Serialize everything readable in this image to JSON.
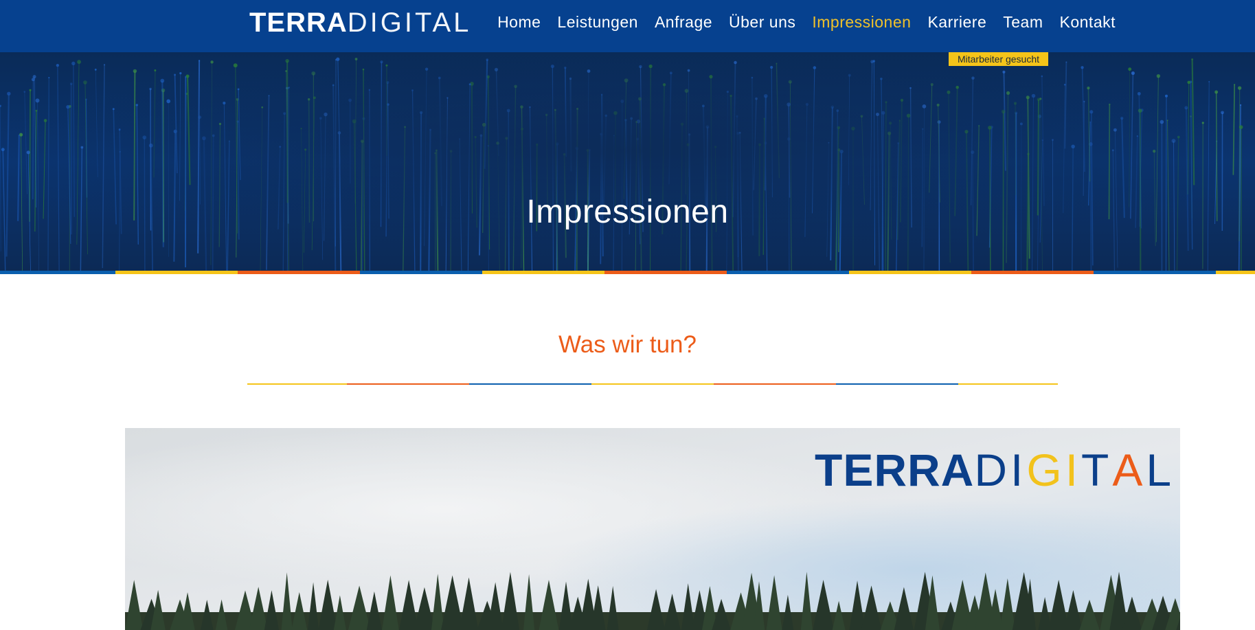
{
  "header": {
    "logo": {
      "bold": "TERRA",
      "light": "DIGITAL"
    },
    "nav": [
      {
        "label": "Home",
        "active": false
      },
      {
        "label": "Leistungen",
        "active": false
      },
      {
        "label": "Anfrage",
        "active": false
      },
      {
        "label": "Über uns",
        "active": false
      },
      {
        "label": "Impressionen",
        "active": true
      },
      {
        "label": "Karriere",
        "active": false
      },
      {
        "label": "Team",
        "active": false
      },
      {
        "label": "Kontakt",
        "active": false
      }
    ],
    "badge": "Mitarbeiter gesucht"
  },
  "hero": {
    "title": "Impressionen"
  },
  "section": {
    "title": "Was wir tun?"
  },
  "photo": {
    "logo": {
      "terra": "TERRA",
      "d": "D",
      "i1": "I",
      "g": "G",
      "i2": "I",
      "t": "T",
      "a": "A",
      "l": "L"
    }
  },
  "colors": {
    "header_bg": "#06418f",
    "nav_active": "#f0c12a",
    "badge_bg": "#f5c419",
    "accent_orange": "#ec5c19",
    "accent_yellow": "#f5c419",
    "accent_blue": "#0b5fae",
    "logo_navy": "#0b3f8a"
  }
}
